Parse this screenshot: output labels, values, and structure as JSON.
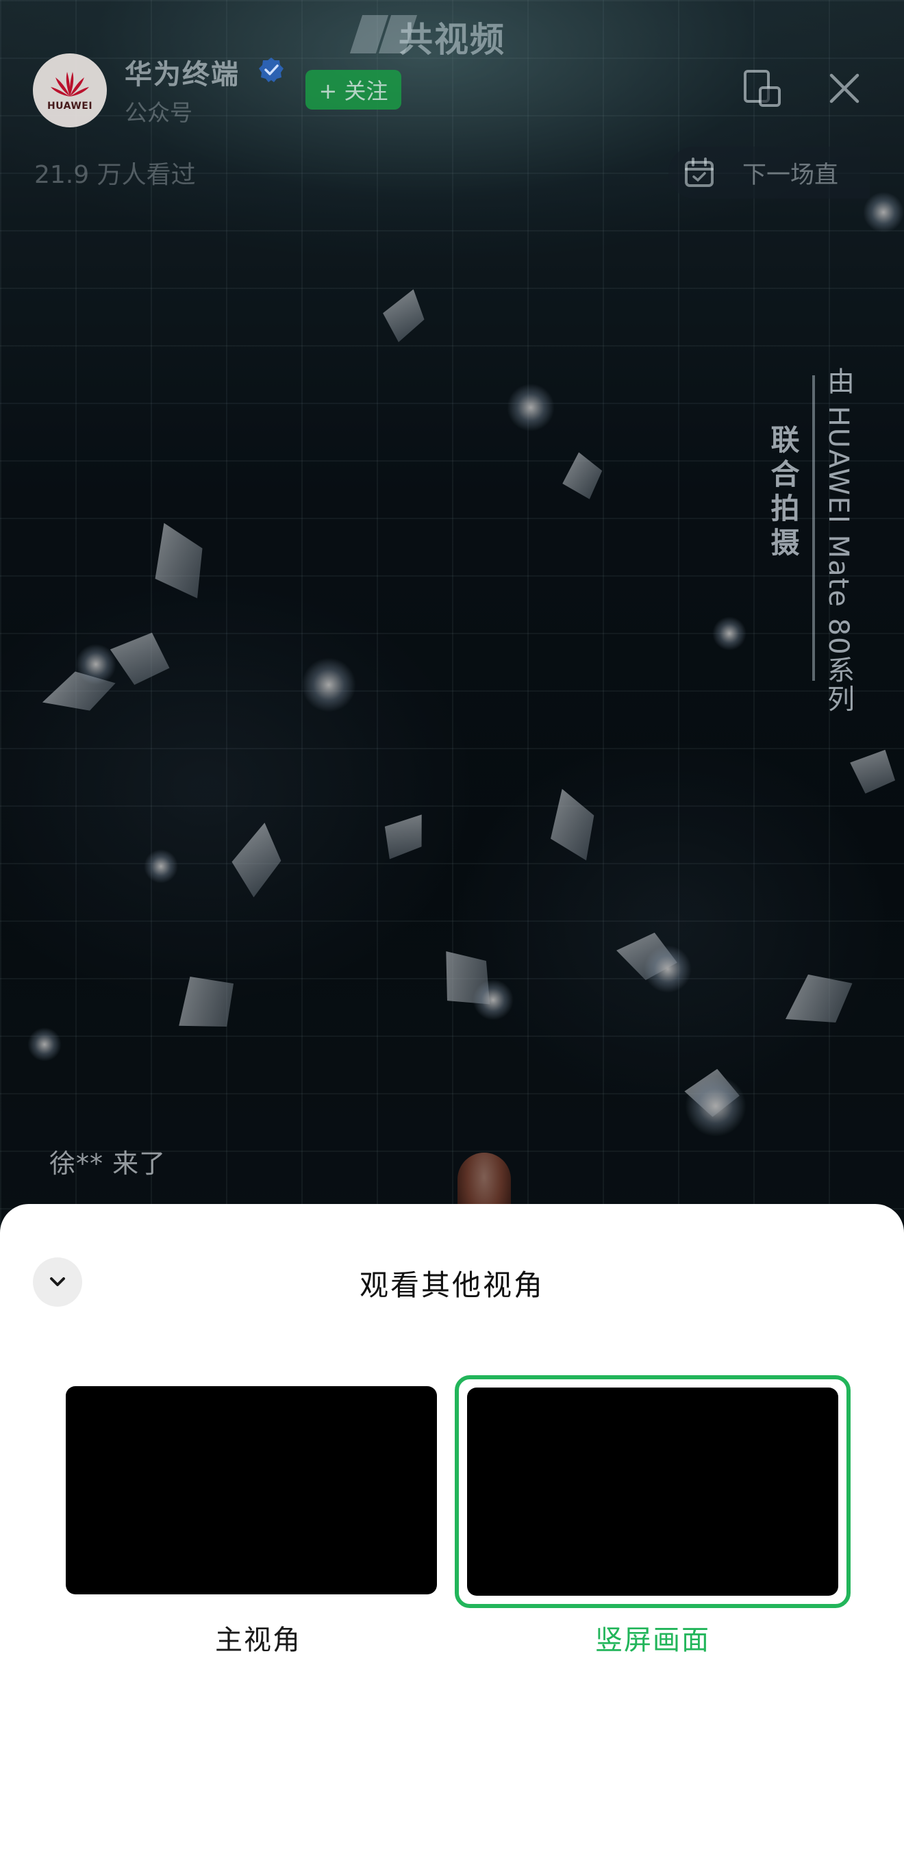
{
  "header": {
    "title": "共视频",
    "account_name": "华为终端",
    "account_type": "公众号",
    "avatar_brand": "HUAWEI",
    "follow_label": "+ 关注",
    "viewers": "21.9 万人看过",
    "next_label": "下一场直"
  },
  "video": {
    "caption_main": "由 HUAWEI Mate 80系列",
    "caption_sub": "联合拍摄",
    "join_message": "徐** 来了"
  },
  "sheet": {
    "title": "观看其他视角",
    "views": [
      {
        "label": "主视角",
        "selected": false
      },
      {
        "label": "竖屏画面",
        "selected": true
      }
    ]
  },
  "colors": {
    "accent_green": "#22b55a",
    "follow_green": "#1a9a45",
    "verified_blue": "#2d6fd8",
    "huawei_red": "#c8102e"
  },
  "icons": [
    "huawei-logo-icon",
    "verified-icon",
    "window-icon",
    "close-icon",
    "calendar-icon",
    "chevron-down-icon"
  ]
}
